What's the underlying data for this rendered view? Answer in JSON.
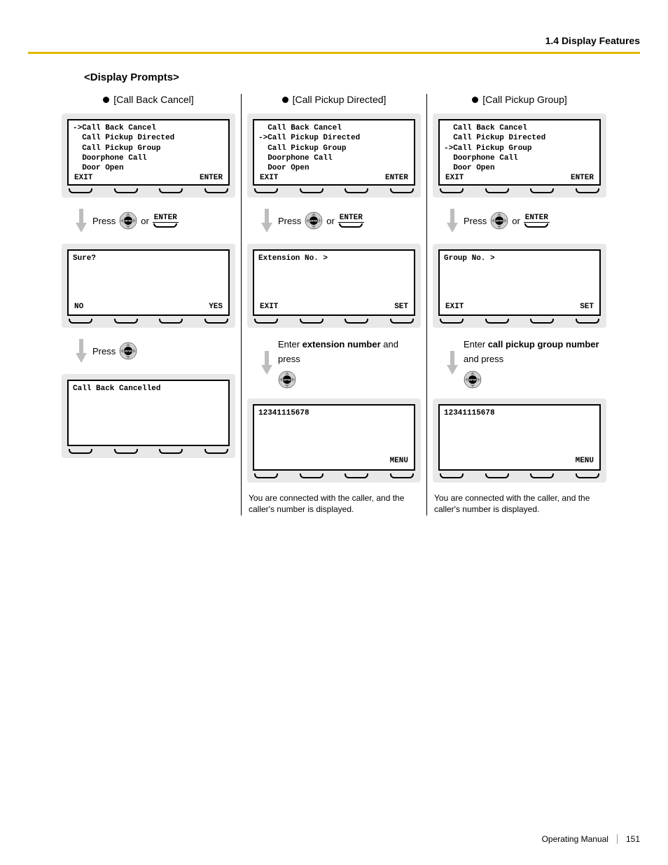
{
  "header": {
    "section": "1.4 Display Features"
  },
  "title": "<Display Prompts>",
  "menuItems": [
    "Call Back Cancel",
    "Call Pickup Directed",
    "Call Pickup Group",
    "Doorphone Call",
    "Door Open"
  ],
  "softLabels": {
    "exit": "EXIT",
    "enter": "ENTER",
    "no": "NO",
    "yes": "YES",
    "set": "SET",
    "menu": "MENU"
  },
  "common": {
    "press": "Press",
    "or": "or",
    "enterBtn": "ENTER"
  },
  "cols": [
    {
      "title": "[Call Back Cancel]",
      "selectedIndex": 0,
      "screen2": {
        "body": "Sure?",
        "left": "NO",
        "right": "YES"
      },
      "step2text": "Press",
      "screen3": {
        "body": "Call Back Cancelled",
        "left": "",
        "right": ""
      },
      "note": ""
    },
    {
      "title": "[Call Pickup Directed]",
      "selectedIndex": 1,
      "screen2": {
        "body": "Extension No. >",
        "left": "EXIT",
        "right": "SET"
      },
      "step2parts": [
        "Enter ",
        "extension number",
        " and press"
      ],
      "screen3": {
        "body": "12341115678",
        "left": "",
        "right": "MENU"
      },
      "note": "You are connected with the caller, and the caller's number is displayed."
    },
    {
      "title": "[Call Pickup Group]",
      "selectedIndex": 2,
      "screen2": {
        "body": "Group No. >",
        "left": "EXIT",
        "right": "SET"
      },
      "step2parts": [
        "Enter ",
        "call pickup group number",
        " and press"
      ],
      "screen3": {
        "body": "12341115678",
        "left": "",
        "right": "MENU"
      },
      "note": "You are connected with the caller, and the caller's number is displayed."
    }
  ],
  "footer": {
    "doc": "Operating Manual",
    "page": "151"
  }
}
